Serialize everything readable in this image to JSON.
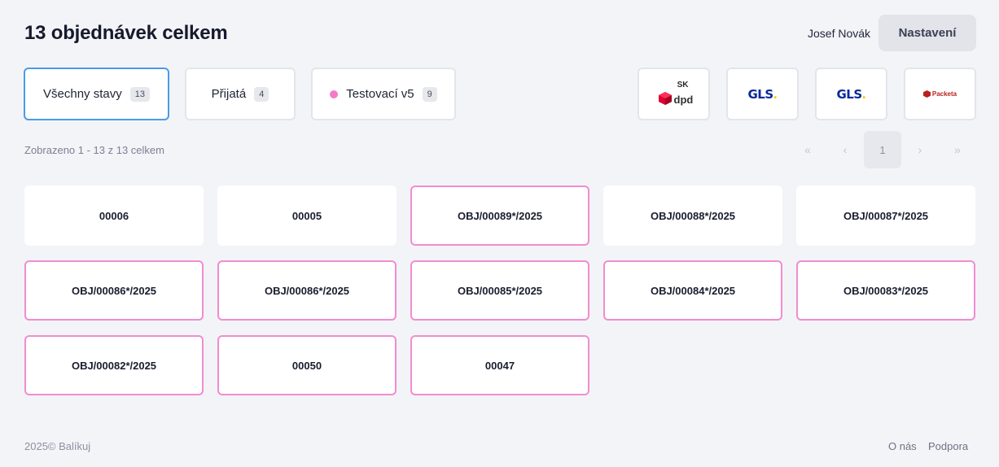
{
  "header": {
    "title": "13 objednávek celkem",
    "user_name": "Josef Novák",
    "settings_label": "Nastavení"
  },
  "filters": [
    {
      "label": "Všechny stavy",
      "count": "13",
      "active": true
    },
    {
      "label": "Přijatá",
      "count": "4"
    },
    {
      "label": "Testovací v5",
      "count": "9",
      "dot_color": "#f47bc9"
    }
  ],
  "carriers": [
    {
      "name": "dpd",
      "badge": "SK",
      "icon": "dpd-logo-icon"
    },
    {
      "name": "GLS",
      "icon": "gls-logo-icon"
    },
    {
      "name": "GLS",
      "icon": "gls-logo-icon"
    },
    {
      "name": "Packeta",
      "icon": "packeta-logo-icon"
    }
  ],
  "summary": "Zobrazeno 1 - 13 z 13 celkem",
  "pagination": {
    "first": "«",
    "prev": "‹",
    "current": "1",
    "next": "›",
    "last": "»"
  },
  "orders": [
    {
      "id": "00006",
      "flagged": false
    },
    {
      "id": "00005",
      "flagged": false
    },
    {
      "id": "OBJ/00089*/2025",
      "flagged": true
    },
    {
      "id": "OBJ/00088*/2025",
      "flagged": false
    },
    {
      "id": "OBJ/00087*/2025",
      "flagged": false
    },
    {
      "id": "OBJ/00086*/2025",
      "flagged": true
    },
    {
      "id": "OBJ/00086*/2025",
      "flagged": true
    },
    {
      "id": "OBJ/00085*/2025",
      "flagged": true
    },
    {
      "id": "OBJ/00084*/2025",
      "flagged": true
    },
    {
      "id": "OBJ/00083*/2025",
      "flagged": true
    },
    {
      "id": "OBJ/00082*/2025",
      "flagged": true
    },
    {
      "id": "00050",
      "flagged": true
    },
    {
      "id": "00047",
      "flagged": true
    }
  ],
  "colors": {
    "flag_border": "#f28cd0",
    "active_border": "#4a9be6"
  },
  "footer": {
    "copyright": "2025© Balíkuj",
    "links": [
      "O nás",
      "Podpora"
    ]
  }
}
